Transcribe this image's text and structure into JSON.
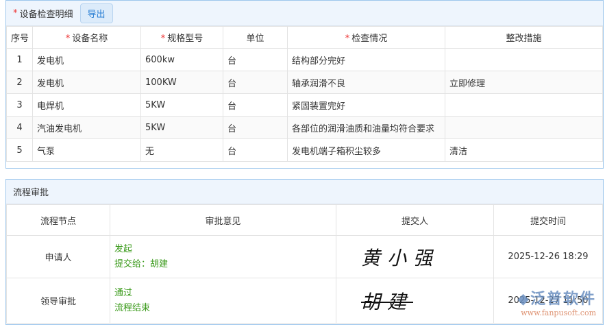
{
  "detail": {
    "title": "设备检查明细",
    "export_label": "导出",
    "columns": [
      {
        "label": "序号",
        "required": false
      },
      {
        "label": "设备名称",
        "required": true
      },
      {
        "label": "规格型号",
        "required": true
      },
      {
        "label": "单位",
        "required": false
      },
      {
        "label": "检查情况",
        "required": true
      },
      {
        "label": "整改措施",
        "required": false
      }
    ],
    "rows": [
      [
        "1",
        "发电机",
        "600kw",
        "台",
        "结构部分完好",
        ""
      ],
      [
        "2",
        "发电机",
        "100KW",
        "台",
        "轴承润滑不良",
        "立即修理"
      ],
      [
        "3",
        "电焊机",
        "5KW",
        "台",
        "紧固装置完好",
        ""
      ],
      [
        "4",
        "汽油发电机",
        "5KW",
        "台",
        "各部位的润滑油质和油量均符合要求",
        ""
      ],
      [
        "5",
        "气泵",
        "无",
        "台",
        "发电机端子箱积尘较多",
        "清洁"
      ]
    ]
  },
  "approval": {
    "title": "流程审批",
    "columns": [
      "流程节点",
      "审批意见",
      "提交人",
      "提交时间"
    ],
    "rows": [
      {
        "node": "申请人",
        "opinion": [
          "发起",
          "提交给：胡建"
        ],
        "signature": "黄小强",
        "time": "2025-12-26 18:29"
      },
      {
        "node": "领导审批",
        "opinion": [
          "通过",
          "流程结束"
        ],
        "signature": "胡建",
        "time": "2025-12-27 11:50"
      }
    ]
  },
  "watermark": {
    "name": "泛普软件",
    "url": "www.fanpusoft.com"
  }
}
